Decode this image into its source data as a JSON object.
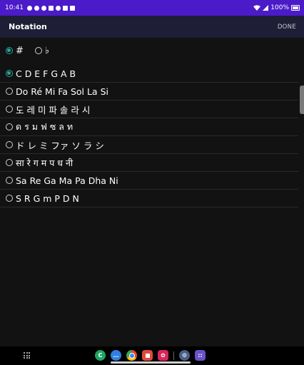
{
  "status_bar": {
    "time": "10:41",
    "battery": "100%"
  },
  "toolbar": {
    "title": "Notation",
    "done_label": "DONE"
  },
  "accidentals": [
    {
      "label": "#",
      "selected": true
    },
    {
      "label": "♭",
      "selected": false
    }
  ],
  "notations": [
    {
      "label": "C D E F G A B",
      "selected": true
    },
    {
      "label": "Do Ré Mi Fa Sol La Si",
      "selected": false
    },
    {
      "label": "도 레 미 파 솔 라 시",
      "selected": false
    },
    {
      "label": "ด ร ม ฟ ซ ล ท",
      "selected": false
    },
    {
      "label": "ド レ ミ ファ ソ ラ シ",
      "selected": false
    },
    {
      "label": "सा रे ग म प ध नी",
      "selected": false
    },
    {
      "label": "Sa Re Ga Ma Pa Dha Ni",
      "selected": false
    },
    {
      "label": "S R G m P D N",
      "selected": false
    }
  ],
  "dock": {
    "apps": [
      {
        "icon": "c-app-icon",
        "glyph": "C",
        "color": "#1fa463"
      },
      {
        "icon": "messages-icon",
        "glyph": "…",
        "color": "#2f7fe0"
      },
      {
        "icon": "chrome-icon",
        "glyph": "",
        "color": "#e0a020"
      },
      {
        "icon": "flipboard-icon",
        "glyph": "",
        "color": "#e0483c"
      },
      {
        "icon": "flower-app-icon",
        "glyph": "✿",
        "color": "#d8265a"
      },
      {
        "icon": "settings-icon",
        "glyph": "⚙",
        "color": "#4a5f86"
      },
      {
        "icon": "apps-folder-icon",
        "glyph": "::",
        "color": "#6a52c8"
      }
    ]
  },
  "colors": {
    "status_bar": "#4b1bc9",
    "toolbar": "#1e1e36",
    "accent": "#26a69a",
    "background": "#121212"
  }
}
